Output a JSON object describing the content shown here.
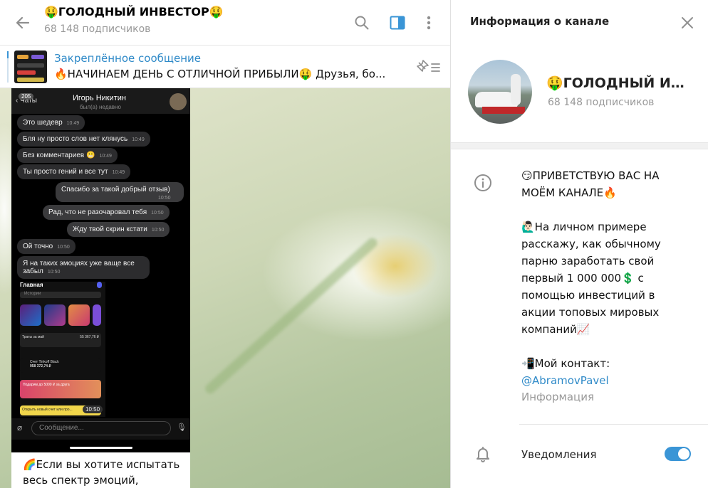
{
  "chat": {
    "title": "🤑ГОЛОДНЫЙ ИНВЕСТОР🤑",
    "subscribers": "68 148 подписчиков",
    "pinned": {
      "label": "Закреплённое сообщение",
      "text": "🔥НАЧИНАЕМ ДЕНЬ С ОТЛИЧНОЙ ПРИБЫЛИ🤑  Друзья, бо..."
    },
    "icons": [
      "back-arrow-icon",
      "search-icon",
      "side-panel-icon",
      "more-vertical-icon",
      "unpin-list-icon"
    ],
    "screenshot": {
      "badge": "205",
      "back_label": "Чаты",
      "contact_name": "Игорь Никитин",
      "seen": "был(а) недавно",
      "messages": [
        {
          "text": "Это шедевр",
          "time": "10:49",
          "out": false
        },
        {
          "text": "Бля ну просто слов нет клянусь",
          "time": "10:49",
          "out": false
        },
        {
          "text": "Без комментариев 😬",
          "time": "10:49",
          "out": false
        },
        {
          "text": "Ты просто гений и все тут",
          "time": "10:49",
          "out": false
        },
        {
          "text": "Спасибо за такой добрый отзыв)",
          "time": "10:50",
          "out": true
        },
        {
          "text": "Рад, что не разочаровал тебя",
          "time": "10:50",
          "out": true
        },
        {
          "text": "Жду твой скрин кстати",
          "time": "10:50",
          "out": true
        },
        {
          "text": "Ой точно",
          "time": "10:50",
          "out": false
        },
        {
          "text": "Я на таких эмоциях уже ваще все забыл",
          "time": "10:50",
          "out": false
        }
      ],
      "app": {
        "title": "Главная",
        "search": "Истории",
        "spend_label": "Траты за май",
        "spend_value": "55 367,76 ₽",
        "account_label": "Счет Tinkoff Black",
        "account_value": "958 372,74 ₽",
        "promo": "Подарим до 5000 ₽ за друга",
        "open_account": "Открыть новый счет или про...",
        "video_time": "10:50"
      },
      "input_placeholder": "Сообщение..."
    },
    "message_text": "🌈Если вы хотите испытать весь спектр эмоций,"
  },
  "info": {
    "header_title": "Информация о канале",
    "channel_name": "🤑ГОЛОДНЫЙ ИН...",
    "subscribers": "68 148 подписчиков",
    "description": {
      "p1": "😏ПРИВЕТСТВУЮ ВАС НА МОЁМ КАНАЛЕ🔥",
      "p2": "🙋🏻‍♂️На личном примере расскажу, как обычному парню заработать свой первый 1 000 000💲 с помощью инвестиций в акции топовых мировых компаний📈",
      "p3": "📲Мой контакт:",
      "contact": "@AbramovPavel",
      "label": "Информация"
    },
    "notifications": {
      "label": "Уведомления",
      "enabled": true
    },
    "icons": [
      "close-icon",
      "info-icon",
      "bell-icon"
    ],
    "colors": {
      "accent": "#3a95d6",
      "link": "#2f8ac8",
      "muted": "#999999"
    }
  }
}
